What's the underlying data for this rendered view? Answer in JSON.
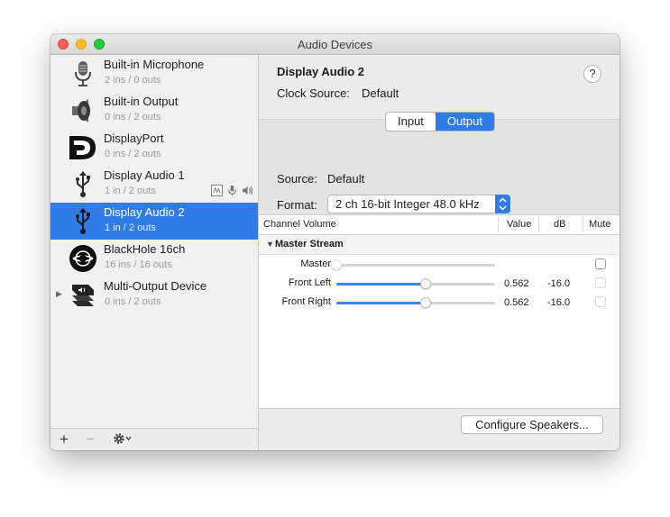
{
  "window": {
    "title": "Audio Devices"
  },
  "sidebar": {
    "devices": [
      {
        "name": "Built-in Microphone",
        "io": "2 ins / 0 outs",
        "icon": "microphone-icon",
        "selected": false
      },
      {
        "name": "Built-in Output",
        "io": "0 ins / 2 outs",
        "icon": "speaker-icon",
        "selected": false
      },
      {
        "name": "DisplayPort",
        "io": "0 ins / 2 outs",
        "icon": "displayport-icon",
        "selected": false
      },
      {
        "name": "Display Audio 1",
        "io": "1 in / 2 outs",
        "icon": "usb-icon",
        "selected": false
      },
      {
        "name": "Display Audio 2",
        "io": "1 in / 2 outs",
        "icon": "usb-icon",
        "selected": true
      },
      {
        "name": "BlackHole 16ch",
        "io": "16 ins / 16 outs",
        "icon": "blackhole-icon",
        "selected": false
      },
      {
        "name": "Multi-Output Device",
        "io": "0 ins / 2 outs",
        "icon": "multi-output-icon",
        "selected": false
      }
    ],
    "footer": {
      "add": "+",
      "remove": "−",
      "gear": "⚙˅"
    }
  },
  "main": {
    "device_title": "Display Audio 2",
    "clock_label": "Clock Source:",
    "clock_value": "Default",
    "help": "?",
    "tabs": [
      {
        "label": "Input",
        "active": false
      },
      {
        "label": "Output",
        "active": true
      }
    ],
    "source_label": "Source:",
    "source_value": "Default",
    "format_label": "Format:",
    "format_value": "2 ch 16-bit Integer 48.0 kHz",
    "table": {
      "headers": {
        "channel": "Channel Volume",
        "value": "Value",
        "db": "dB",
        "mute": "Mute"
      },
      "group": "Master Stream",
      "rows": [
        {
          "label": "Master",
          "level": 0.0,
          "value": "",
          "db": "",
          "enabled": false
        },
        {
          "label": "Front Left",
          "level": 0.562,
          "value": "0.562",
          "db": "-16.0",
          "enabled": true
        },
        {
          "label": "Front Right",
          "level": 0.562,
          "value": "0.562",
          "db": "-16.0",
          "enabled": true
        }
      ]
    },
    "configure_button": "Configure Speakers..."
  },
  "colors": {
    "accent": "#2f7ce6"
  }
}
